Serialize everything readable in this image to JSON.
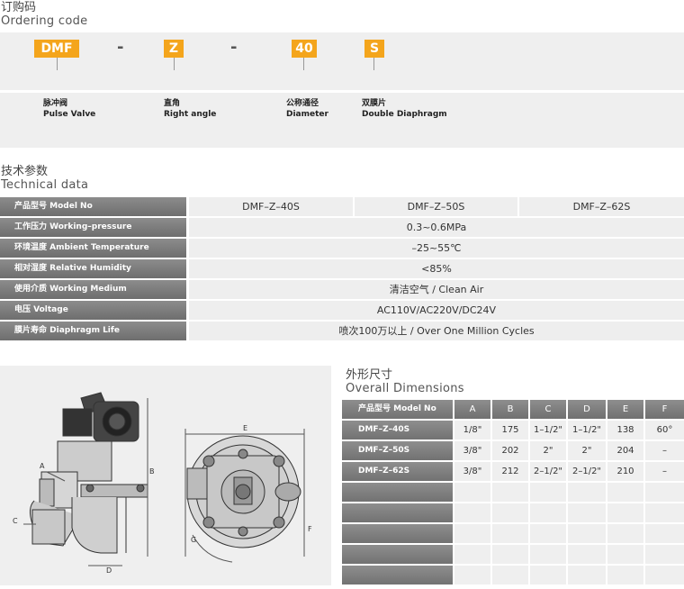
{
  "ordering": {
    "title_cn": "订购码",
    "title_en": "Ordering code",
    "codes": [
      {
        "code": "DMF",
        "cn": "脉冲阀",
        "en": "Pulse Valve"
      },
      {
        "code": "Z",
        "cn": "直角",
        "en": "Right angle"
      },
      {
        "code": "40",
        "cn": "公称通径",
        "en": "Diameter"
      },
      {
        "code": "S",
        "cn": "双膜片",
        "en": "Double Diaphragm"
      }
    ],
    "dash": "-",
    "accent_color": "#f4a51c"
  },
  "tech": {
    "title_cn": "技术参数",
    "title_en": "Technical data",
    "rows": [
      {
        "label": "产品型号  Model No",
        "values": [
          "DMF–Z–40S",
          "DMF–Z–50S",
          "DMF–Z–62S"
        ]
      },
      {
        "label": "工作压力  Working–pressure",
        "value": "0.3~0.6MPa"
      },
      {
        "label": "环境温度  Ambient Temperature",
        "value": "–25~55℃"
      },
      {
        "label": "相对湿度  Relative Humidity",
        "value": "<85%"
      },
      {
        "label": "使用介质  Working Medium",
        "value": "清洁空气 / Clean Air"
      },
      {
        "label": "电压  Voltage",
        "value": "AC110V/AC220V/DC24V"
      },
      {
        "label": "膜片寿命  Diaphragm Life",
        "value": "喷次100万以上 / Over One Million Cycles"
      }
    ]
  },
  "dimensions": {
    "title_cn": "外形尺寸",
    "title_en": "Overall Dimensions",
    "header_model": "产品型号  Model No",
    "columns": [
      "A",
      "B",
      "C",
      "D",
      "E",
      "F"
    ],
    "rows": [
      {
        "model": "DMF–Z–40S",
        "values": [
          "1/8\"",
          "175",
          "1–1/2\"",
          "1–1/2\"",
          "138",
          "60°"
        ]
      },
      {
        "model": "DMF–Z–50S",
        "values": [
          "3/8\"",
          "202",
          "2\"",
          "2\"",
          "204",
          "–"
        ]
      },
      {
        "model": "DMF–Z–62S",
        "values": [
          "3/8\"",
          "212",
          "2–1/2\"",
          "2–1/2\"",
          "210",
          "–"
        ]
      }
    ],
    "empty_rows": 5
  },
  "drawing": {
    "labels": [
      "A",
      "B",
      "C",
      "D",
      "E",
      "F",
      "G"
    ]
  }
}
